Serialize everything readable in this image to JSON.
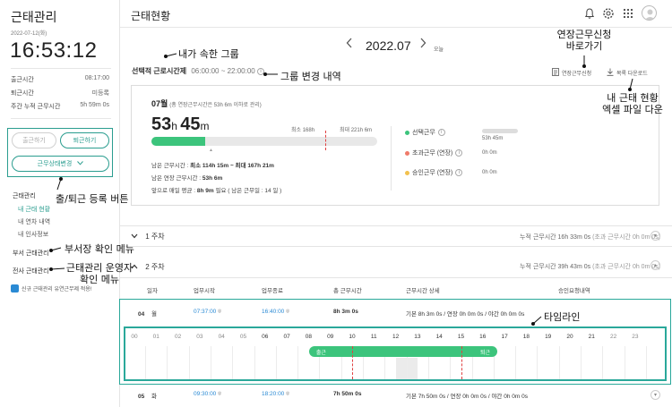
{
  "sidebar": {
    "title": "근태관리",
    "date": "2022-07-12(화)",
    "clock": "16:53:12",
    "rows": [
      {
        "label": "출근시간",
        "value": "08:17:00"
      },
      {
        "label": "퇴근시간",
        "value": "미등록"
      },
      {
        "label": "주간 누적 근무시간",
        "value": "5h 59m 0s"
      }
    ],
    "btn_in": "출근하기",
    "btn_out": "퇴근하기",
    "btn_status": "근무상태변경",
    "nav": {
      "group1": "근태관리",
      "item1": "내 근태 현황",
      "item2": "내 연차 내역",
      "item3": "내 인사정보",
      "group2": "부서 근태관리",
      "group3": "전사 근태관리"
    },
    "notice": "신규 근태관리 유연근무제 적용!"
  },
  "header": {
    "title": "근태현황",
    "icons": [
      "bell-icon",
      "gear-icon",
      "apps-grid-icon",
      "avatar-icon"
    ]
  },
  "month": {
    "label": "2022.07",
    "today": "오늘"
  },
  "group": {
    "name": "선택적 근로시간제",
    "time": "06:00:00 ~ 22:00:00"
  },
  "actions": {
    "extend": "연장근무신청",
    "download": "목록 다운로드"
  },
  "summary": {
    "month_title": "07월",
    "month_note": "(총 연장근무시간은 53h 6m 이하로 관리)",
    "big_h": "53",
    "big_m": "45",
    "min_label": "최소 168h",
    "max_label": "최대 221h 6m",
    "progress": 0.24,
    "line1_label": "남은 근무시간 : ",
    "line1_value": "최소 114h 15m ~ 최대 167h 21m",
    "line2_label": "남은 연장 근무시간 : ",
    "line2_value": "53h 6m",
    "line3_label": "앞으로 매일 평균 : ",
    "line3_value": "8h 9m",
    "line3_tail": " 필요 ( 남은 근무일 : 14 일 )",
    "legend": [
      {
        "label": "선택근무",
        "value": "53h 45m",
        "color": "#3cc47c"
      },
      {
        "label": "초과근무 (연장)",
        "value": "0h 0m",
        "color": "#f07a6a"
      },
      {
        "label": "승인근무 (연장)",
        "value": "0h 0m",
        "color": "#f2c14e"
      }
    ]
  },
  "weeks": [
    {
      "label": "1 주차",
      "prefix": "누적 근무시간 ",
      "total": "16h 33m 0s",
      "extra": "(초과 근무시간 0h 0m 0s)"
    },
    {
      "label": "2 주차",
      "prefix": "누적 근무시간 ",
      "total": "39h 43m 0s",
      "extra": "(초과 근무시간 0h 0m 0s)"
    }
  ],
  "table": {
    "headers": [
      "일자",
      "업무시작",
      "업무종료",
      "총 근무시간",
      "근무시간 상세",
      "승인요청내역"
    ],
    "rows": [
      {
        "day": "04",
        "dow": "월",
        "start": "07:37:00",
        "end": "16:40:00",
        "total": "8h 3m 0s",
        "detail": "기본 8h 3m 0s / 연장 0h 0m 0s / 야간 0h 0m 0s"
      },
      {
        "day": "05",
        "dow": "화",
        "start": "09:30:00",
        "end": "18:20:00",
        "total": "7h 50m 0s",
        "detail": "기본 7h 50m 0s / 연장 0h 0m 0s / 야간 0h 0m 0s"
      }
    ]
  },
  "timeline": {
    "hours": [
      "00",
      "01",
      "02",
      "03",
      "04",
      "05",
      "06",
      "07",
      "08",
      "09",
      "10",
      "11",
      "12",
      "13",
      "14",
      "15",
      "16",
      "17",
      "18",
      "19",
      "20",
      "21",
      "22",
      "23"
    ],
    "start_hour": 7.62,
    "end_hour": 16.67,
    "start_label": "출근",
    "end_label": "퇴근",
    "red_lines": [
      10,
      15
    ],
    "shade": [
      12,
      13
    ]
  },
  "annotations": {
    "group": "내가 속한 그룹",
    "group_history": "그룹 변경 내역",
    "extend_shortcut": "연장근무신청\n바로가기",
    "excel": "내 근태 현황\n엑셀 파일 다운",
    "btn_register": "출/퇴근 등록 버튼",
    "dept_menu": "부서장 확인 메뉴",
    "admin_menu": "근태관리 운영자\n확인 메뉴",
    "timeline": "타임라인"
  }
}
